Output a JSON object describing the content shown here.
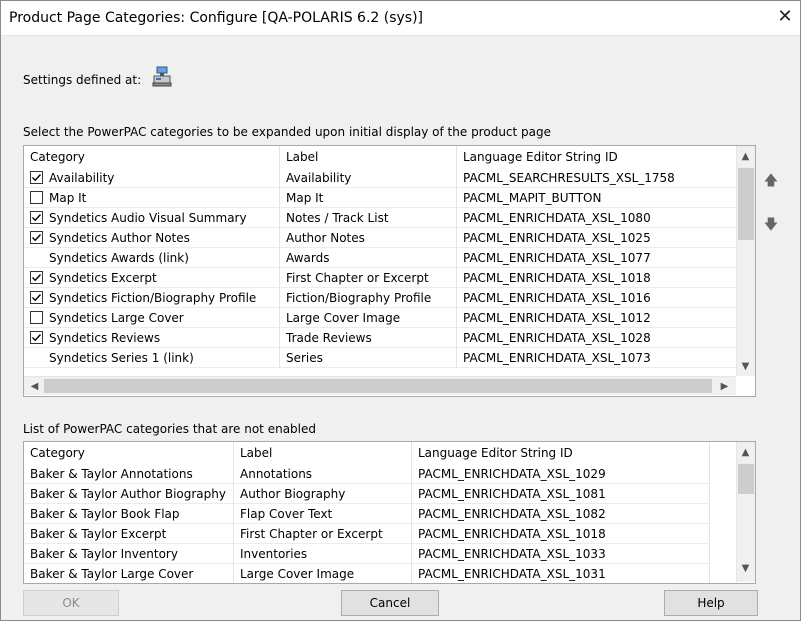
{
  "window": {
    "title": "Product Page Categories: Configure [QA-POLARIS 6.2 (sys)]",
    "close_glyph": "✕"
  },
  "settings": {
    "label": "Settings defined at:",
    "icon": "computer-system-icon"
  },
  "enabled_section": {
    "label": "Select the PowerPAC categories to be expanded upon initial display of the product page",
    "columns": [
      "Category",
      "Label",
      "Language Editor String ID"
    ],
    "rows": [
      {
        "has_checkbox": true,
        "checked": true,
        "category": "Availability",
        "label": "Availability",
        "string_id": "PACML_SEARCHRESULTS_XSL_1758"
      },
      {
        "has_checkbox": true,
        "checked": false,
        "category": "Map It",
        "label": "Map It",
        "string_id": "PACML_MAPIT_BUTTON"
      },
      {
        "has_checkbox": true,
        "checked": true,
        "category": "Syndetics Audio Visual Summary",
        "label": "Notes / Track List",
        "string_id": "PACML_ENRICHDATA_XSL_1080"
      },
      {
        "has_checkbox": true,
        "checked": true,
        "category": "Syndetics Author Notes",
        "label": "Author Notes",
        "string_id": "PACML_ENRICHDATA_XSL_1025"
      },
      {
        "has_checkbox": false,
        "checked": false,
        "category": "Syndetics Awards (link)",
        "label": "Awards",
        "string_id": "PACML_ENRICHDATA_XSL_1077"
      },
      {
        "has_checkbox": true,
        "checked": true,
        "category": "Syndetics Excerpt",
        "label": "First Chapter or Excerpt",
        "string_id": "PACML_ENRICHDATA_XSL_1018"
      },
      {
        "has_checkbox": true,
        "checked": true,
        "category": "Syndetics Fiction/Biography Profile",
        "label": "Fiction/Biography Profile",
        "string_id": "PACML_ENRICHDATA_XSL_1016"
      },
      {
        "has_checkbox": true,
        "checked": false,
        "category": "Syndetics Large Cover",
        "label": "Large Cover Image",
        "string_id": "PACML_ENRICHDATA_XSL_1012"
      },
      {
        "has_checkbox": true,
        "checked": true,
        "category": "Syndetics Reviews",
        "label": "Trade Reviews",
        "string_id": "PACML_ENRICHDATA_XSL_1028"
      },
      {
        "has_checkbox": false,
        "checked": false,
        "category": "Syndetics Series 1 (link)",
        "label": "Series",
        "string_id": "PACML_ENRICHDATA_XSL_1073"
      }
    ]
  },
  "disabled_section": {
    "label": "List of PowerPAC categories that are not enabled",
    "columns": [
      "Category",
      "Label",
      "Language Editor String ID"
    ],
    "rows": [
      {
        "category": "Baker & Taylor Annotations",
        "label": "Annotations",
        "string_id": "PACML_ENRICHDATA_XSL_1029"
      },
      {
        "category": "Baker & Taylor Author Biography",
        "label": "Author Biography",
        "string_id": "PACML_ENRICHDATA_XSL_1081"
      },
      {
        "category": "Baker & Taylor Book Flap",
        "label": "Flap Cover Text",
        "string_id": "PACML_ENRICHDATA_XSL_1082"
      },
      {
        "category": "Baker & Taylor Excerpt",
        "label": "First Chapter or Excerpt",
        "string_id": "PACML_ENRICHDATA_XSL_1018"
      },
      {
        "category": "Baker & Taylor Inventory",
        "label": "Inventories",
        "string_id": "PACML_ENRICHDATA_XSL_1033"
      },
      {
        "category": "Baker & Taylor Large Cover",
        "label": "Large Cover Image",
        "string_id": "PACML_ENRICHDATA_XSL_1031"
      }
    ]
  },
  "side_buttons": {
    "up_icon": "move-up-arrow-icon",
    "down_icon": "move-down-arrow-icon"
  },
  "buttons": {
    "ok": "OK",
    "cancel": "Cancel",
    "help": "Help"
  },
  "colors": {
    "check": "#000000",
    "background": "#f0f0f0",
    "scroll_thumb": "#cdcdcd"
  }
}
